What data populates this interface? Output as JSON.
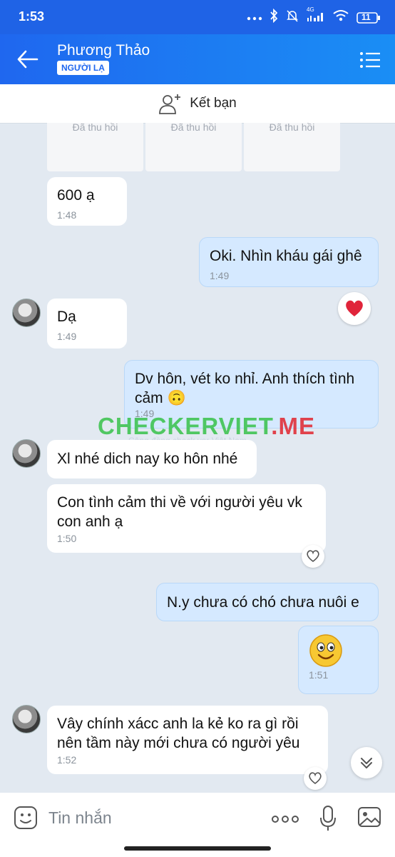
{
  "status_bar": {
    "time": "1:53",
    "network": "4G",
    "battery": "11"
  },
  "header": {
    "contact_name": "Phương Thảo",
    "badge": "NGƯỜI LẠ"
  },
  "add_friend": {
    "label": "Kết bạn"
  },
  "file_items": [
    "Đã thu hồi",
    "Đã thu hồi",
    "Đã thu hồi"
  ],
  "messages": [
    {
      "sender": "them",
      "text": "600 ạ",
      "time": "1:48"
    },
    {
      "sender": "me",
      "text": "Oki. Nhìn kháu gái ghê",
      "time": "1:49"
    },
    {
      "sender": "them",
      "text": "Dạ",
      "time": "1:49",
      "reaction": "heart"
    },
    {
      "sender": "me",
      "text": "Dv hôn, vét ko nhỉ. Anh thích tình cảm 🙃",
      "time": "1:49"
    },
    {
      "sender": "them",
      "text": "Xl nhé dich nay ko hôn nhé",
      "time": ""
    },
    {
      "sender": "them",
      "text": "Con tình cảm thi về với người yêu vk con anh ạ",
      "time": "1:50"
    },
    {
      "sender": "me",
      "text": "N.y chưa có chó chưa nuôi e",
      "time": ""
    },
    {
      "sender": "me",
      "text": "🙂",
      "time": "1:51"
    },
    {
      "sender": "them",
      "text": "Vây chính xácc anh la kẻ ko ra gì  rồi nên tầm này mới chưa có người yêu",
      "time": "1:52"
    }
  ],
  "watermark": {
    "text": "CHECKERVIET",
    "suffix": ".ME",
    "subtext": "Cộng đồng check var Việt Nam"
  },
  "input": {
    "placeholder": "Tin nhắn"
  },
  "colors": {
    "header": "#1f67ef",
    "outgoing_bubble": "#d5e9ff",
    "incoming_bubble": "#ffffff",
    "background": "#e2e9f1",
    "heart": "#e0243a"
  }
}
